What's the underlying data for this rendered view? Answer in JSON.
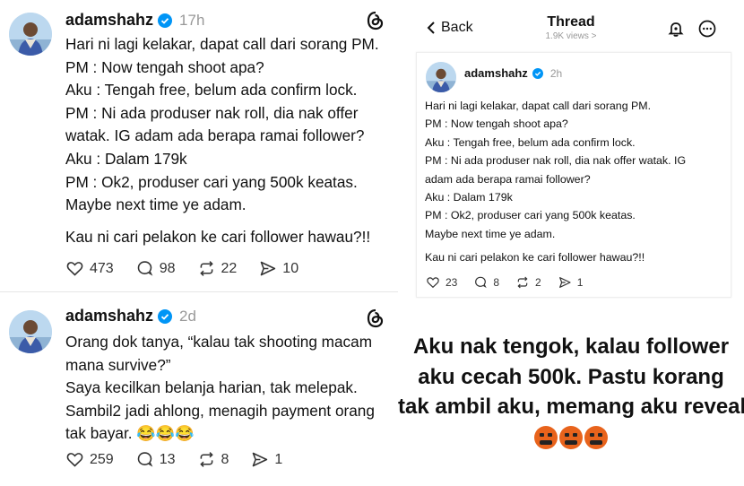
{
  "left": {
    "post1": {
      "username": "adamshahz",
      "time": "17h",
      "lines": [
        "Hari ni lagi kelakar, dapat call dari sorang PM.",
        "PM : Now tengah shoot apa?",
        "Aku : Tengah free, belum ada confirm lock.",
        "PM : Ni ada produser nak roll, dia nak offer",
        "watak. IG adam ada berapa ramai follower?",
        "Aku : Dalam 179k",
        "PM : Ok2, produser cari yang 500k keatas.",
        "Maybe next time ye adam."
      ],
      "last_line": "Kau ni cari pelakon ke cari follower hawau?!!",
      "likes": "473",
      "replies": "98",
      "reposts": "22",
      "shares": "10"
    },
    "post2": {
      "username": "adamshahz",
      "time": "2d",
      "lines": [
        "Orang dok tanya, “kalau tak shooting macam",
        "mana survive?”",
        "Saya kecilkan belanja harian, tak melepak.",
        "Sambil2 jadi ahlong, menagih payment orang",
        "tak bayar. 😂😂😂"
      ],
      "likes": "259",
      "replies": "13",
      "reposts": "8",
      "shares": "1"
    }
  },
  "right": {
    "header": {
      "back_label": "Back",
      "title": "Thread",
      "views": "1.9K views >"
    },
    "post": {
      "username": "adamshahz",
      "time": "2h",
      "lines": [
        "Hari ni lagi kelakar, dapat call dari sorang PM.",
        "PM : Now tengah shoot apa?",
        "Aku : Tengah free, belum ada confirm lock.",
        "PM : Ni ada produser nak roll, dia nak offer watak. IG",
        "adam ada berapa ramai follower?",
        "Aku : Dalam 179k",
        "PM : Ok2, produser cari yang 500k keatas.",
        "Maybe next time ye adam."
      ],
      "last_line": "Kau ni cari pelakon ke cari follower hawau?!!",
      "likes": "23",
      "replies": "8",
      "reposts": "2",
      "shares": "1"
    },
    "caption_lines": [
      "Aku nak tengok, kalau follower",
      "aku cecah 500k. Pastu korang",
      "tak ambil aku, memang aku reveal"
    ]
  },
  "colors": {
    "verified": "#0095f6",
    "text": "#111111",
    "muted": "#999999",
    "emoji": "#e8631c"
  },
  "icons": [
    "heart-icon",
    "comment-icon",
    "repost-icon",
    "share-icon",
    "threads-logo-icon",
    "verified-icon",
    "back-chevron-icon",
    "notification-bell-icon",
    "more-options-icon",
    "angry-face-icon"
  ]
}
